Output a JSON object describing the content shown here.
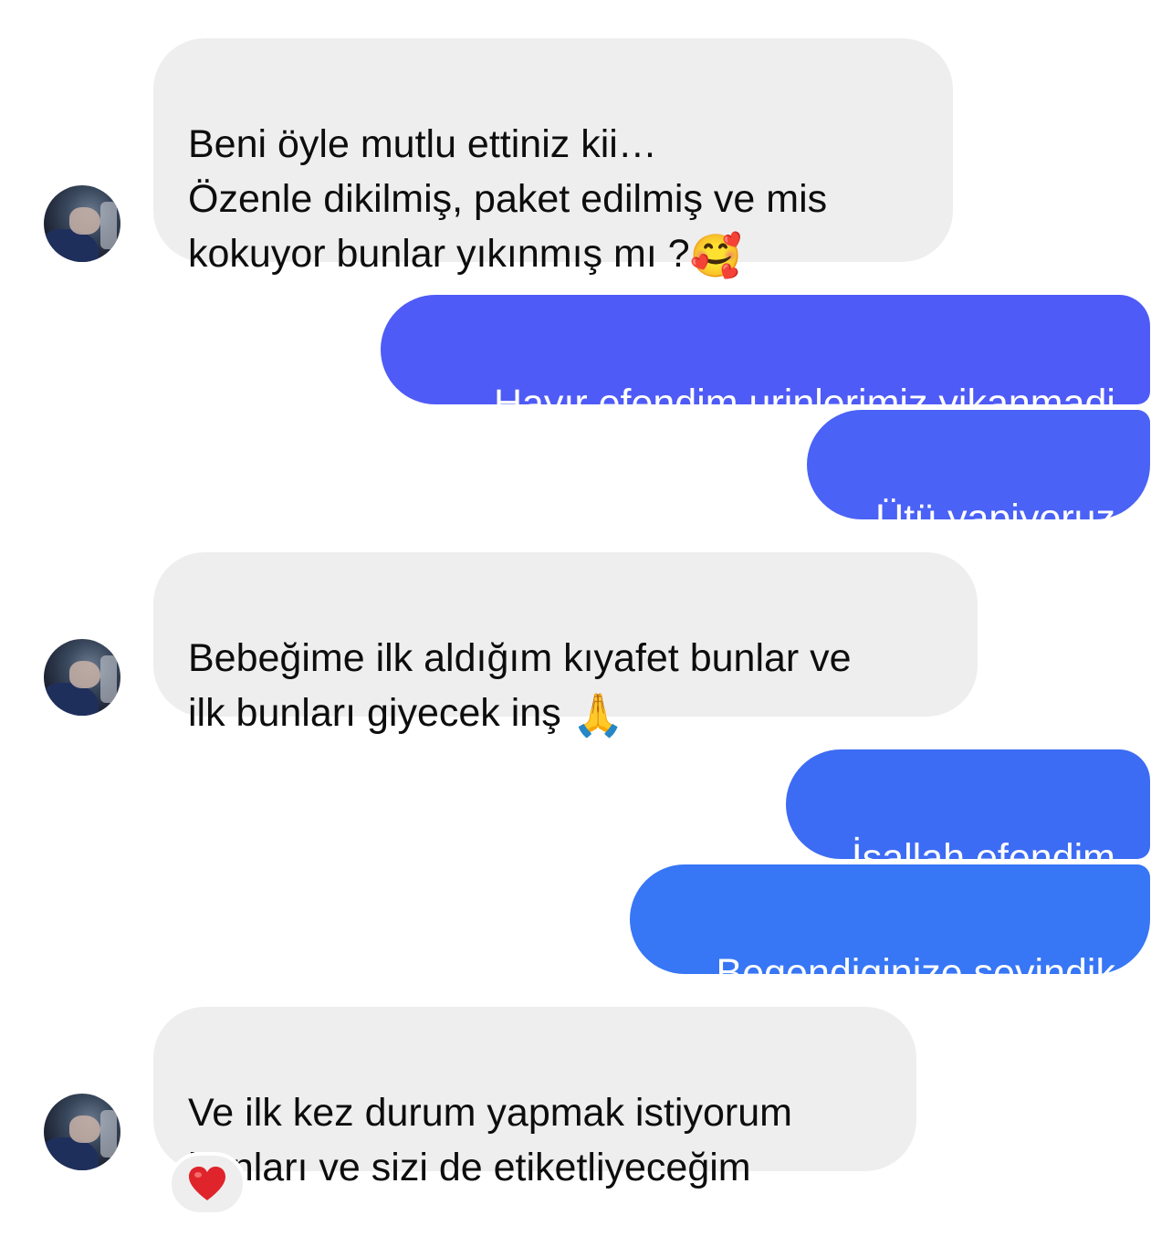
{
  "messages": [
    {
      "side": "incoming",
      "text": "Beni öyle mutlu ettiniz kii…\nÖzenle dikilmiş, paket edilmiş ve mis\nkokuyor bunlar yıkınmış mı ?",
      "emoji": "🥰"
    },
    {
      "side": "outgoing",
      "text": "Hayır efendim urinlerimiz yikanmadi",
      "color": "#4f5bf6"
    },
    {
      "side": "outgoing",
      "text": "Ütü yapiyoruz",
      "color": "#4a62f5"
    },
    {
      "side": "incoming",
      "text": "Bebeğime ilk aldığım kıyafet bunlar ve\nilk bunları giyecek inş",
      "emoji": "🙏"
    },
    {
      "side": "outgoing",
      "text": "İsallah efendim",
      "color": "#3d6cf4"
    },
    {
      "side": "outgoing",
      "text": "Begendiginize sevindik",
      "color": "#3776f5"
    },
    {
      "side": "incoming",
      "text": "Ve ilk kez durum yapmak istiyorum\nbunları ve sizi de etiketliyeceğim"
    }
  ],
  "reaction": {
    "emoji": "❤️",
    "color": "#e0242b"
  },
  "colors": {
    "incoming_bg": "#eeeeee",
    "incoming_text": "#0d0d0d",
    "outgoing_text": "#ffffff"
  }
}
